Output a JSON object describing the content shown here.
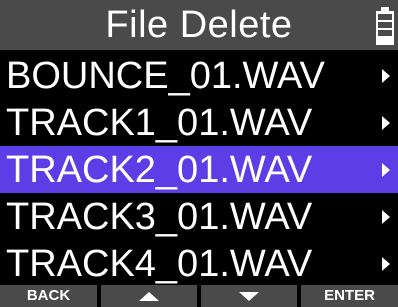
{
  "header": {
    "title": "File Delete",
    "battery_icon": "battery-icon"
  },
  "list": {
    "items": [
      {
        "label": "BOUNCE_01.WAV",
        "selected": false
      },
      {
        "label": "TRACK1_01.WAV",
        "selected": false
      },
      {
        "label": "TRACK2_01.WAV",
        "selected": true
      },
      {
        "label": "TRACK3_01.WAV",
        "selected": false
      },
      {
        "label": "TRACK4_01.WAV",
        "selected": false
      }
    ],
    "chevron_icon": "chevron-right-icon"
  },
  "footer": {
    "back_label": "BACK",
    "up_icon": "up-arrow-icon",
    "down_icon": "down-arrow-icon",
    "enter_label": "ENTER"
  },
  "colors": {
    "header_bg": "#4a4a4a",
    "selected_bg": "#5b3ee6",
    "background": "#000000",
    "text": "#ffffff"
  }
}
